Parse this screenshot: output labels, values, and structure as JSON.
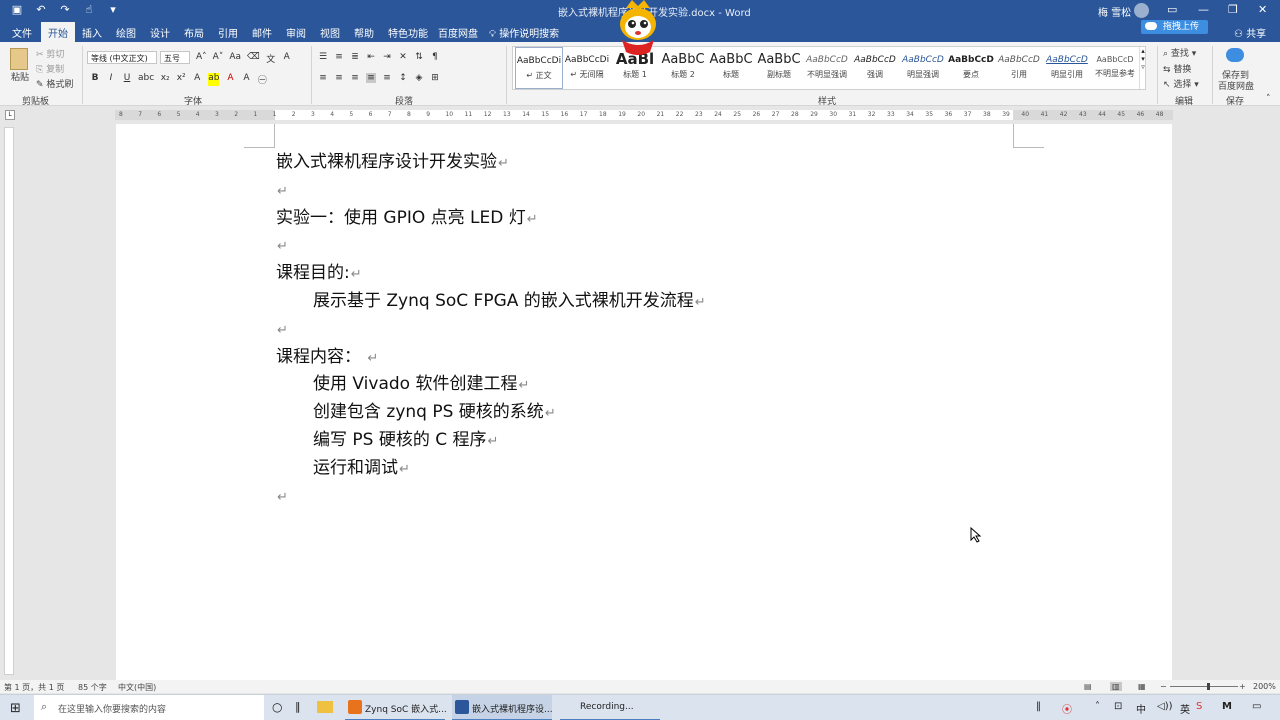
{
  "titlebar": {
    "doc_title": "嵌入式裸机程序设计开发实验.docx - Word",
    "user_name": "梅 雪松",
    "qa_icons": [
      "save-icon",
      "undo-icon",
      "redo-icon",
      "touch-icon",
      "customize-icon"
    ]
  },
  "tabs": [
    "文件",
    "开始",
    "插入",
    "绘图",
    "设计",
    "布局",
    "引用",
    "邮件",
    "审阅",
    "视图",
    "帮助",
    "特色功能",
    "百度网盘"
  ],
  "active_tab": "开始",
  "tell_me": "操作说明搜索",
  "share": "共享",
  "upload_label": "拖拽上传",
  "ribbon": {
    "clipboard": {
      "paste": "粘贴",
      "cut": "剪切",
      "copy": "复制",
      "format_painter": "格式刷",
      "label": "剪贴板"
    },
    "font": {
      "family": "等线 (中文正文)",
      "size": "五号",
      "label": "字体"
    },
    "paragraph": {
      "label": "段落"
    },
    "styles": {
      "label": "样式",
      "items": [
        {
          "sample": "AaBbCcDi",
          "name": "↵ 正文"
        },
        {
          "sample": "AaBbCcDi",
          "name": "↵ 无间隔"
        },
        {
          "sample": "AaBl",
          "name": "标题 1"
        },
        {
          "sample": "AaBbC",
          "name": "标题 2"
        },
        {
          "sample": "AaBbC",
          "name": "标题"
        },
        {
          "sample": "AaBbC",
          "name": "副标题"
        },
        {
          "sample": "AaBbCcD",
          "name": "不明显强调"
        },
        {
          "sample": "AaBbCcD",
          "name": "强调"
        },
        {
          "sample": "AaBbCcD",
          "name": "明显强调"
        },
        {
          "sample": "AaBbCcD",
          "name": "要点"
        },
        {
          "sample": "AaBbCcD",
          "name": "引用"
        },
        {
          "sample": "AaBbCcD",
          "name": "明显引用"
        },
        {
          "sample": "AaBbCcD",
          "name": "不明显参考"
        }
      ]
    },
    "editing": {
      "find": "查找",
      "replace": "替换",
      "select": "选择",
      "label": "编辑"
    },
    "save": {
      "save_to": "保存到",
      "baidu": "百度网盘",
      "label": "保存"
    }
  },
  "document": {
    "lines": [
      {
        "text": "嵌入式裸机程序设计开发实验",
        "indent": 0
      },
      {
        "text": "",
        "indent": 0
      },
      {
        "text": "实验一：使用 GPIO 点亮 LED 灯",
        "indent": 0
      },
      {
        "text": "",
        "indent": 0
      },
      {
        "text": "课程目的:",
        "indent": 0
      },
      {
        "text": "展示基于 Zynq SoC FPGA 的嵌入式裸机开发流程",
        "indent": 1
      },
      {
        "text": "",
        "indent": 0
      },
      {
        "text": "课程内容： ",
        "indent": 0
      },
      {
        "text": "使用 Vivado 软件创建工程",
        "indent": 1
      },
      {
        "text": "创建包含 zynq PS 硬核的系统",
        "indent": 1
      },
      {
        "text": "编写 PS 硬核的 C 程序",
        "indent": 1
      },
      {
        "text": "运行和调试",
        "indent": 1
      },
      {
        "text": "",
        "indent": 0
      }
    ],
    "paragraph_mark": "↵"
  },
  "statusbar": {
    "page": "第 1 页，共 1 页",
    "words": "85 个字",
    "language": "中文(中国)",
    "zoom": "200%"
  },
  "taskbar": {
    "search_placeholder": "在这里输入你要搜索的内容",
    "items": [
      {
        "label": "Zynq SoC 嵌入式...",
        "color": "#e8731c"
      },
      {
        "label": "嵌入式裸机程序设...",
        "color": "#2b579a"
      },
      {
        "label": "Recording...",
        "color": "#555555"
      }
    ]
  },
  "ruler_numbers": [
    "8",
    "7",
    "6",
    "5",
    "4",
    "3",
    "2",
    "1",
    "1",
    "2",
    "3",
    "4",
    "5",
    "6",
    "7",
    "8",
    "9",
    "10",
    "11",
    "12",
    "13",
    "14",
    "15",
    "16",
    "17",
    "18",
    "19",
    "20",
    "21",
    "22",
    "23",
    "24",
    "25",
    "26",
    "27",
    "28",
    "29",
    "30",
    "31",
    "32",
    "33",
    "34",
    "35",
    "36",
    "37",
    "38",
    "39",
    "40",
    "41",
    "42",
    "43",
    "44",
    "45",
    "46",
    "48"
  ]
}
